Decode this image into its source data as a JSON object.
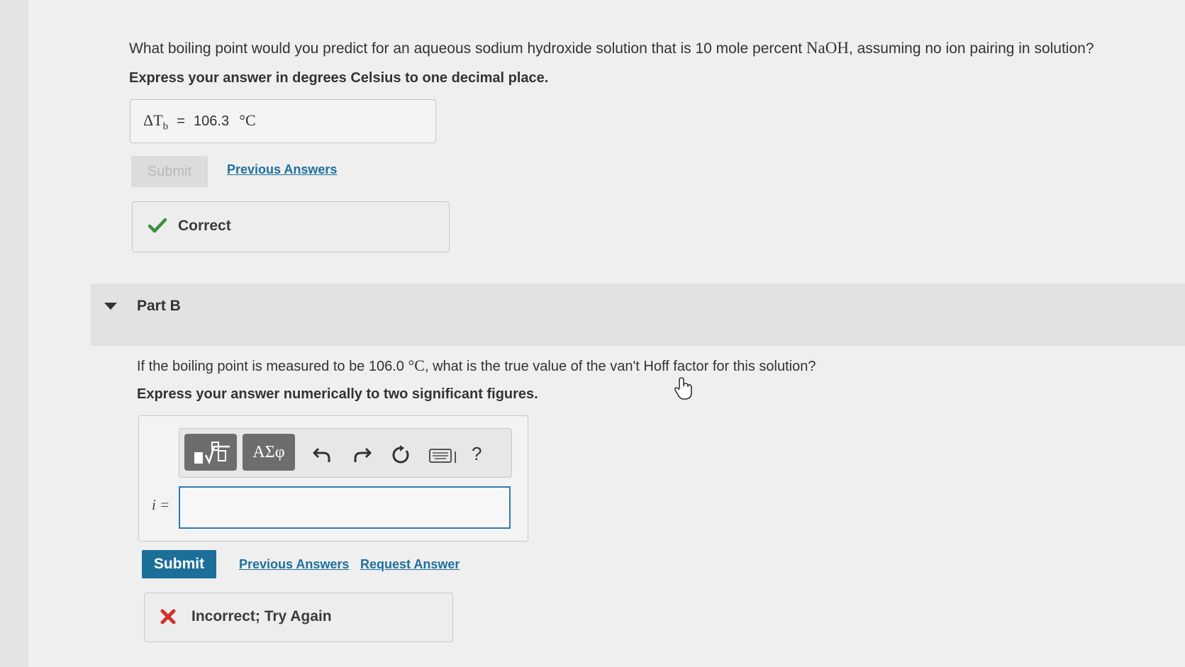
{
  "partA": {
    "question_pre": "What boiling point would you predict for an aqueous sodium hydroxide solution that is 10 mole percent ",
    "formula": "NaOH",
    "question_post": ", assuming no ion pairing in solution?",
    "instruction": "Express your answer in degrees Celsius to one decimal place.",
    "answer_symbol": "ΔT",
    "answer_subscript": "b",
    "answer_equals": "=",
    "answer_value": "106.3",
    "answer_unit": "°C",
    "submit_label": "Submit",
    "previous_answers_label": "Previous Answers",
    "feedback_text": "Correct"
  },
  "partB": {
    "title": "Part B",
    "question_pre": "If the boiling point is measured to be 106.0 ",
    "question_unit": "°C",
    "question_post": ", what is the true value of the van't Hoff factor for this solution?",
    "instruction": "Express your answer numerically to two significant figures.",
    "toolbar": {
      "template_icon": "template-sqrt-icon",
      "symbols_label": "ΑΣφ",
      "undo_icon": "undo-icon",
      "redo_icon": "redo-icon",
      "reset_icon": "reset-icon",
      "keyboard_icon": "keyboard-icon",
      "help_label": "?"
    },
    "variable_label": "i =",
    "input_value": "",
    "submit_label": "Submit",
    "previous_answers_label": "Previous Answers",
    "request_answer_label": "Request Answer",
    "feedback_text": "Incorrect; Try Again"
  },
  "colors": {
    "link": "#1f6f9c",
    "submit_bg": "#1b6f99",
    "correct_check": "#3c8d3c",
    "incorrect_x": "#d0312d",
    "input_border": "#2c7bb6"
  }
}
